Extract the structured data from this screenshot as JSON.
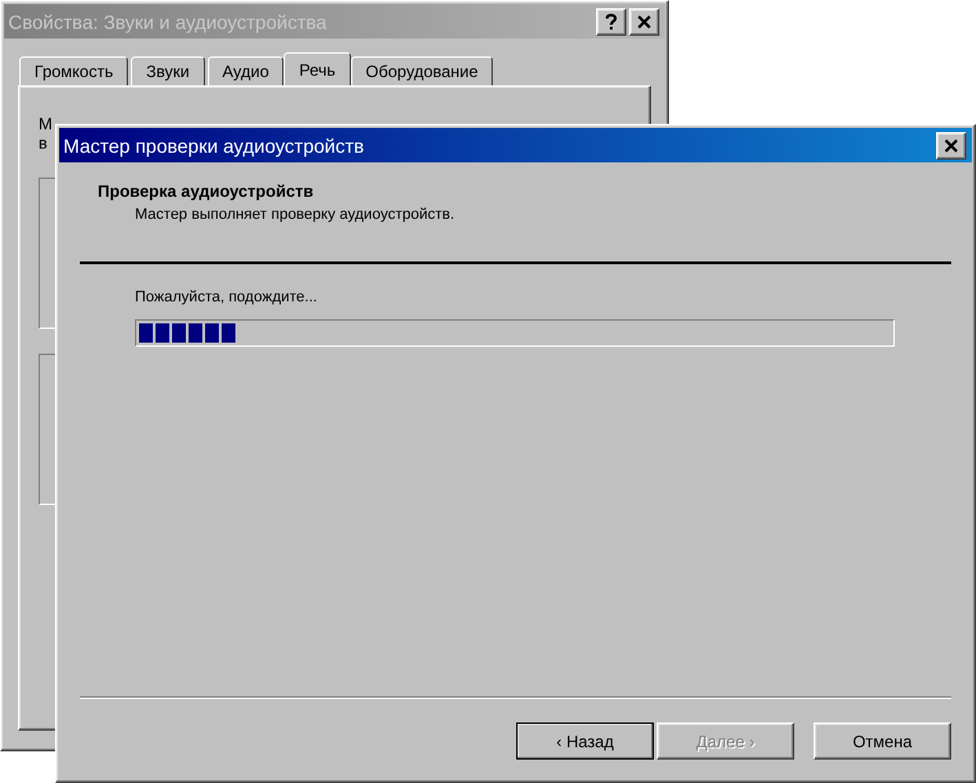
{
  "back_window": {
    "title": "Свойства: Звуки и аудиоустройства",
    "active": false,
    "tabs": [
      {
        "label": "Громкость",
        "selected": false
      },
      {
        "label": "Звуки",
        "selected": false
      },
      {
        "label": "Аудио",
        "selected": false
      },
      {
        "label": "Речь",
        "selected": true
      },
      {
        "label": "Оборудование",
        "selected": false
      }
    ],
    "panel_text": [
      "М",
      "в"
    ]
  },
  "wizard": {
    "title": "Мастер проверки аудиоустройств",
    "active": true,
    "heading": "Проверка аудиоустройств",
    "subheading": "Мастер выполняет проверку аудиоустройств.",
    "status": "Пожалуйста, подождите...",
    "progress": {
      "level": 0.13
    },
    "buttons": [
      {
        "label": "‹ Назад",
        "disabled": false,
        "default": true
      },
      {
        "label": "Далее ›",
        "disabled": true,
        "default": false
      },
      {
        "label": "Отмена",
        "disabled": false,
        "default": false
      }
    ]
  }
}
